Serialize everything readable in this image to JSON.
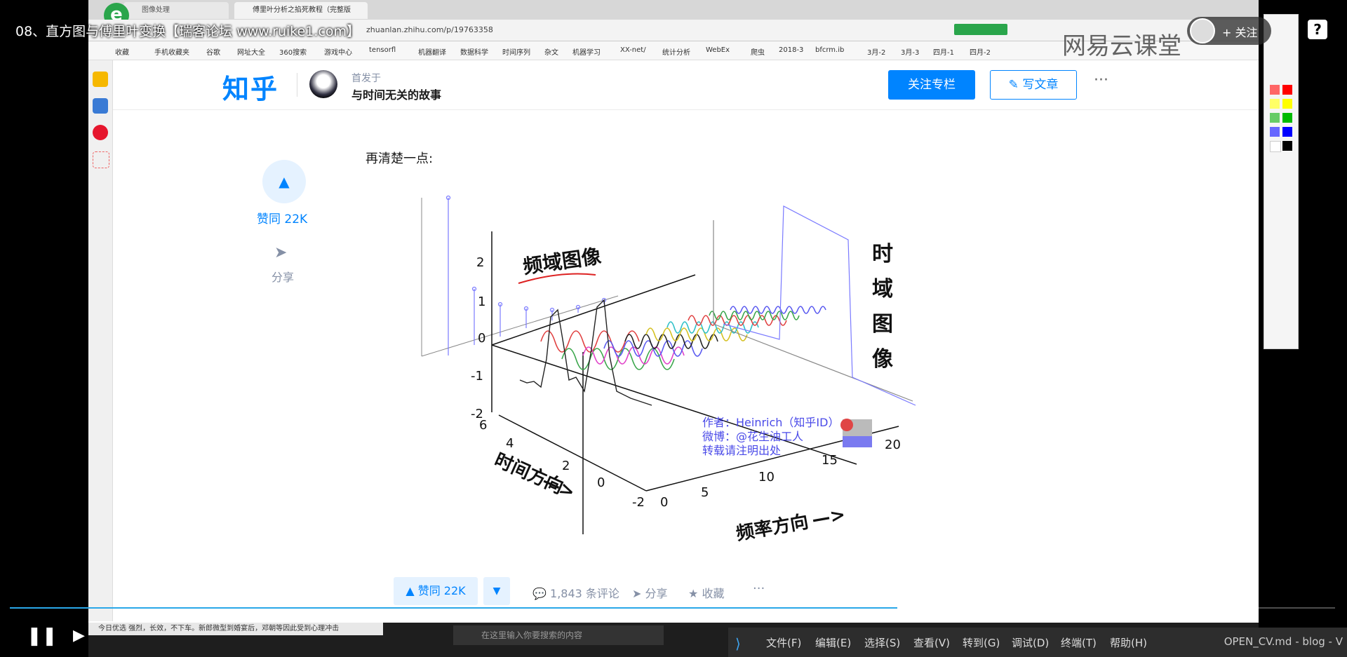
{
  "player": {
    "title": "08、直方图与傅里叶变换【瑞客论坛 www.ruike1.com】",
    "follow_label": "+ 关注",
    "help": "?",
    "watermark": "网易云课堂"
  },
  "browser": {
    "tabs": [
      "图像处理",
      "傅里叶分析之掐死教程（完整版"
    ],
    "url": "zhuanlan.zhihu.com/p/19763358",
    "bookmarks": [
      "收藏",
      "手机收藏夹",
      "谷歌",
      "网址大全",
      "360搜索",
      "游戏中心",
      "tensorfl",
      "机器翻译",
      "数据科学",
      "时间序列",
      "杂文",
      "机器学习",
      "XX-net/",
      "统计分析",
      "WebEx",
      "爬虫",
      "2018-3",
      "bfcrm.ib",
      "3月-2",
      "3月-3",
      "四月-1",
      "四月-2"
    ]
  },
  "zhihu": {
    "logo": "知乎",
    "first_in": "首发于",
    "column_name": "与时间无关的故事",
    "follow_column": "关注专栏",
    "write_article": "写文章",
    "vote_side": "赞同 22K",
    "share_side": "分享",
    "article_text": "再清楚一点:",
    "bottom": {
      "vote": "▲ 赞同 22K",
      "comments": "1,843 条评论",
      "share": "分享",
      "collect": "收藏"
    }
  },
  "figure": {
    "freq_domain_label": "频域图像",
    "time_domain_label": "时域图像",
    "time_direction": "时间方向",
    "freq_direction": "频率方向",
    "credit_author": "作者：Heinrich（知乎ID）",
    "credit_weibo": "微博：@花生油工人",
    "credit_note": "转载请注明出处",
    "z_ticks": [
      "2",
      "1",
      "0",
      "-1",
      "-2"
    ],
    "time_ticks": [
      "6",
      "4",
      "2",
      "0",
      "-2"
    ],
    "freq_ticks": [
      "0",
      "5",
      "10",
      "15",
      "20"
    ]
  },
  "vscode": {
    "menu": [
      "文件(F)",
      "编辑(E)",
      "选择(S)",
      "查看(V)",
      "转到(G)",
      "调试(D)",
      "终端(T)",
      "帮助(H)"
    ],
    "title": "OPEN_CV.md - blog - V"
  },
  "taskbar": {
    "news": "今日优选  强烈，长效，不下车。新郎微型到婚宴后，邓朝等因此受到心理冲击",
    "search_placeholder": "在这里输入你要搜索的内容"
  },
  "colors": {
    "zhihu_blue": "#0084ff",
    "progress": "#2aa7e8"
  }
}
